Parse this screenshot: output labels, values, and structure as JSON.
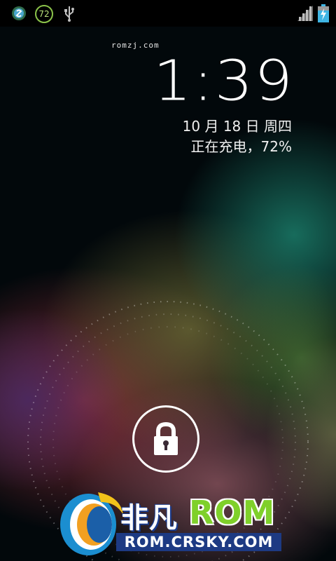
{
  "status_bar": {
    "badge_value": "72",
    "icons": [
      "hiapk-app-icon",
      "battery-percent-badge",
      "usb-icon",
      "signal-strength-icon",
      "battery-charging-icon"
    ]
  },
  "lockscreen": {
    "carrier": "romzj.com",
    "time": "1:39",
    "date": "10 月 18 日 周四",
    "charging_status": "正在充电，72%"
  },
  "lock_handle": {
    "icon": "lock-icon"
  },
  "watermark": {
    "brand_cn": "非凡",
    "brand_rom": "ROM",
    "url": "ROM.CRSKY.COM"
  },
  "colors": {
    "statusbar_bg": "#000000",
    "battery": "#3fb5e3",
    "watermark_blue": "#1d3a83",
    "watermark_green": "#7fd02a"
  }
}
